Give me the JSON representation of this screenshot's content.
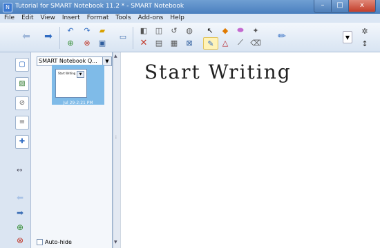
{
  "window": {
    "title": "Tutorial for SMART Notebook 11.2 * - SMART Notebook",
    "minimize": "–",
    "maximize": "□",
    "close": "x"
  },
  "menu": [
    "File",
    "Edit",
    "View",
    "Insert",
    "Format",
    "Tools",
    "Add-ons",
    "Help"
  ],
  "toolbar": {
    "icons": [
      "back-arrow-icon",
      "forward-arrow-icon",
      "undo-icon",
      "redo-icon",
      "open-folder-icon",
      "add-page-icon",
      "delete-page-icon",
      "save-icon",
      "screen-display-icon",
      "capture-icon",
      "table-icon",
      "screen-shade-icon",
      "undo-all-icon",
      "select-arrow-icon",
      "fill-bucket-icon",
      "eraser-icon",
      "magic-pen-icon",
      "pens-icon",
      "shapes-icon",
      "lines-icon",
      "eraser2-icon",
      "pen-icon",
      "settings-icon"
    ]
  },
  "sidebar": {
    "page_sorter_title": "SMART Notebook Q...",
    "thumbnail_date": "Jul 29-2:21 PM",
    "thumbnail_text": "Start Writing",
    "autohide_label": "Auto-hide",
    "tabs": [
      "page-sorter-icon",
      "gallery-icon",
      "attachments-icon",
      "properties-icon",
      "add-ons-icon"
    ]
  },
  "canvas": {
    "ink_text": "Start Writing"
  },
  "colors": {
    "title_bar": "#4a7fbf",
    "menu_bar": "#dbe6f4",
    "thumbnail_bg": "#7fbbe8",
    "arrow_blue": "#3d6fb6"
  }
}
